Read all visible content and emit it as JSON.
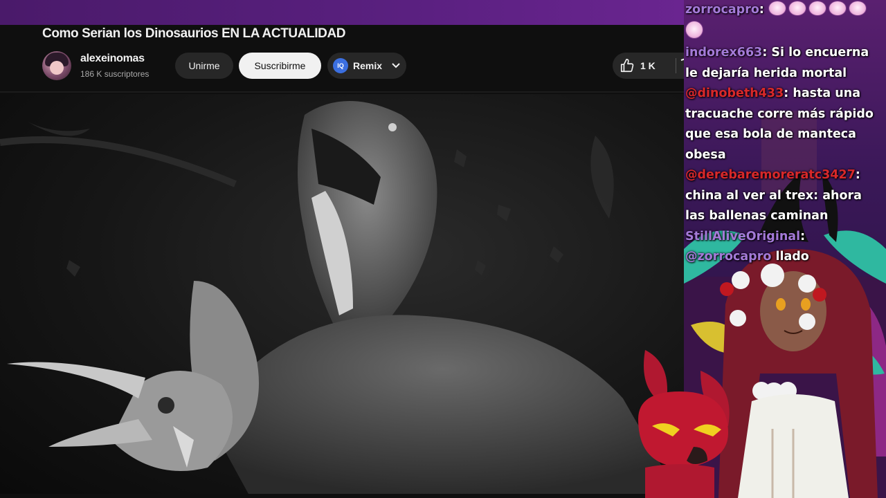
{
  "video": {
    "title": "Como Serian los Dinosaurios EN LA ACTUALIDAD",
    "channel_name": "alexeinomas",
    "subscribers": "186 K suscriptores",
    "join_label": "Unirme",
    "subscribe_label": "Suscribirme",
    "remix_label": "Remix",
    "remix_icon_text": "IQ",
    "like_count": "1 K"
  },
  "chat": {
    "messages": [
      {
        "user": "zorrocapro",
        "text": ""
      },
      {
        "user": "indorex663",
        "text_line1": "Si lo encuerna",
        "text_line2": "le dejaría herida mortal"
      },
      {
        "user": "@dinobeth433",
        "text_line1": "hasta una",
        "text_line2": "tracuache corre más rápido",
        "text_line3": "que esa bola de manteca",
        "text_line4": "obesa"
      },
      {
        "user": "@derebaremoreratc3427",
        "text_line1": "china al ver al trex: ahora",
        "text_line2": "las ballenas caminan"
      },
      {
        "user": "StillAliveOriginal",
        "mention": "@zorrocapro",
        "text": "llado"
      }
    ]
  },
  "colors": {
    "chat_username_purple": "#a47ad8",
    "chat_username_red": "#d8282a",
    "subscribe_bg": "#f1f1f1",
    "overlay_purple": "#5a2080"
  },
  "icons": [
    "thumbs-up-icon",
    "chevron-down-icon",
    "remix-icon",
    "emote-icon"
  ]
}
